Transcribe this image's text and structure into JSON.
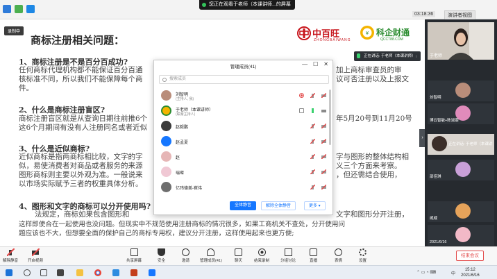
{
  "topbar": {
    "share_notice": "您正在观看于老师（本课讲师...的屏幕",
    "timer": "03:18:36",
    "view_button": "演讲者视图"
  },
  "slide": {
    "recording_chip": "录制中",
    "title": "商标注册相关问题：",
    "logo_left_text": "中百旺",
    "logo_left_sub": "ZHONGBAIWANG",
    "logo_right_text": "科企财通",
    "logo_right_sub": "QCCT88.COM",
    "q1_head": "1、商标注册是不是百分百成功?",
    "q1_line1a": "任何商标代理机构都不能保证百分百通",
    "q1_line1b": "加上商标审查员的审",
    "q1_line2a": "核标准不同，所以我们不能保障每个商",
    "q1_line2b": "议可否注册以及上报文",
    "q1_line3": "件。",
    "q2_head": "2、什么是商标注册盲区?",
    "q2_line1a": "商标注册盲区就是从查询日期往前推6个",
    "q2_line1b": "年5月20号到11月20号",
    "q2_line2": "这6个月期间有没有人注册同名或者近似",
    "q3_head": "3、什么是近似商标?",
    "q3_line1a": "近似商标是指两商标相比较，文字的字",
    "q3_line1b": "字与图形的整体结构相",
    "q3_line2a": "似，易使消费者对商品或者服务的来源",
    "q3_line2b": "义三个方面来考察。",
    "q3_line3a": "图形商标则主要以外观为准。一般说来",
    "q3_line3b": "，但还需结合使用，",
    "q3_line4": "以市场实际赋予三者的权重具体分析。",
    "q4_head": "4、图形和文字的商标可以分开使用吗?",
    "q4_line1a": "法规定，商标如果包含图形和",
    "q4_line1b": "文字和图形分开注册，",
    "q4_line2": "这样即使合在一起使用也没问题。但现实中不规范使用注册商标的情况很多，如果工商机关不查处，分开使用问",
    "q4_line3": "题应该也不大，但想要全面的保护自己的商标专用权，建议分开注册，这样使用起来也更方便;"
  },
  "dialog": {
    "title": "管理成员(41)",
    "search_placeholder": "搜索成员",
    "members": [
      {
        "name": "刘智明",
        "role": "(主持人, 我)"
      },
      {
        "name": "于老师（本课讲师）",
        "role": "(联席主持人)"
      },
      {
        "name": "赵毅鹏",
        "role": ""
      },
      {
        "name": "赵孟夏",
        "role": ""
      },
      {
        "name": "赵",
        "role": ""
      },
      {
        "name": "瑞璨",
        "role": ""
      },
      {
        "name": "亿玮德美-崔伟",
        "role": ""
      }
    ],
    "mute_all": "全体静音",
    "unmute_all": "解除全体静音",
    "more": "更多 ▾",
    "win_min": "—",
    "win_max": "☐",
    "win_close": "✕"
  },
  "rpanel": {
    "main_name": "于老师",
    "speaking_top": "正在讲话: 于老师（本课讲师）;",
    "tiles": [
      {
        "name": "刘智明"
      },
      {
        "name": "博云智敏+陈淑雯"
      },
      {
        "name": "正在讲话: 于老师（本课讲"
      },
      {
        "name": "邵佳琪"
      },
      {
        "name": "威威"
      },
      {
        "name": "2021/6/16"
      }
    ]
  },
  "toolbar": {
    "unmute": "解除静音",
    "video": "开启视频",
    "share": "共享屏幕",
    "security": "安全",
    "invite": "邀请",
    "members": "管理成员(41)",
    "chat": "聊天",
    "record": "结束录制",
    "breakout": "分组讨论",
    "live": "直播",
    "reaction": "表情",
    "settings": "设置",
    "end": "结束会议"
  },
  "taskbar": {
    "time": "15:12",
    "date": "2021/6/16",
    "lang": "中"
  },
  "colors": {
    "accent": "#1677ff",
    "end_red": "#e34b4b",
    "panel_dark": "#262a2f",
    "brand_red": "#c8161d",
    "brand_green": "#2a8c2f"
  }
}
